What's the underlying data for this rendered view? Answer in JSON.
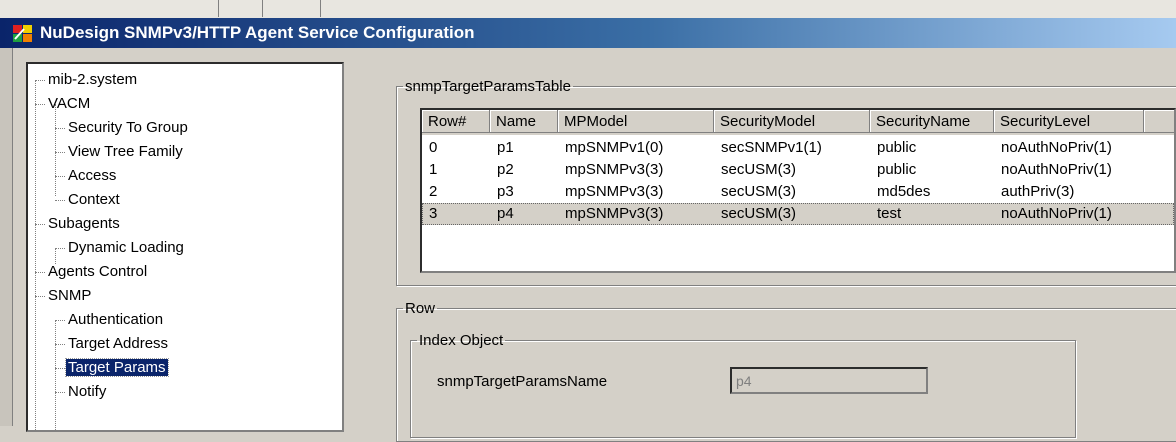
{
  "window": {
    "title": "NuDesign SNMPv3/HTTP Agent Service Configuration"
  },
  "tree": {
    "items": [
      {
        "label": "mib-2.system"
      },
      {
        "label": "VACM"
      },
      {
        "label": "Security To Group"
      },
      {
        "label": "View Tree Family"
      },
      {
        "label": "Access"
      },
      {
        "label": "Context"
      },
      {
        "label": "Subagents"
      },
      {
        "label": "Dynamic Loading"
      },
      {
        "label": "Agents Control"
      },
      {
        "label": "SNMP"
      },
      {
        "label": "Authentication"
      },
      {
        "label": "Target Address"
      },
      {
        "label": "Target Params"
      },
      {
        "label": "Notify"
      }
    ],
    "selected_label": "Target Params"
  },
  "table_group": {
    "legend": "snmpTargetParamsTable",
    "columns": [
      "Row#",
      "Name",
      "MPModel",
      "SecurityModel",
      "SecurityName",
      "SecurityLevel"
    ],
    "rows": [
      [
        "0",
        "p1",
        "mpSNMPv1(0)",
        "secSNMPv1(1)",
        "public",
        "noAuthNoPriv(1)"
      ],
      [
        "1",
        "p2",
        "mpSNMPv3(3)",
        "secUSM(3)",
        "public",
        "noAuthNoPriv(1)"
      ],
      [
        "2",
        "p3",
        "mpSNMPv3(3)",
        "secUSM(3)",
        "md5des",
        "authPriv(3)"
      ],
      [
        "3",
        "p4",
        "mpSNMPv3(3)",
        "secUSM(3)",
        "test",
        "noAuthNoPriv(1)"
      ]
    ],
    "selected_row": 3
  },
  "row_group": {
    "legend": "Row",
    "index_group": {
      "legend": "Index Object",
      "field_label": "snmpTargetParamsName",
      "field_value": "p4"
    }
  },
  "colors": {
    "titlebar_start": "#0a246a",
    "titlebar_end": "#a6caf0",
    "selection": "#0a246a",
    "face": "#d4d0c8"
  }
}
